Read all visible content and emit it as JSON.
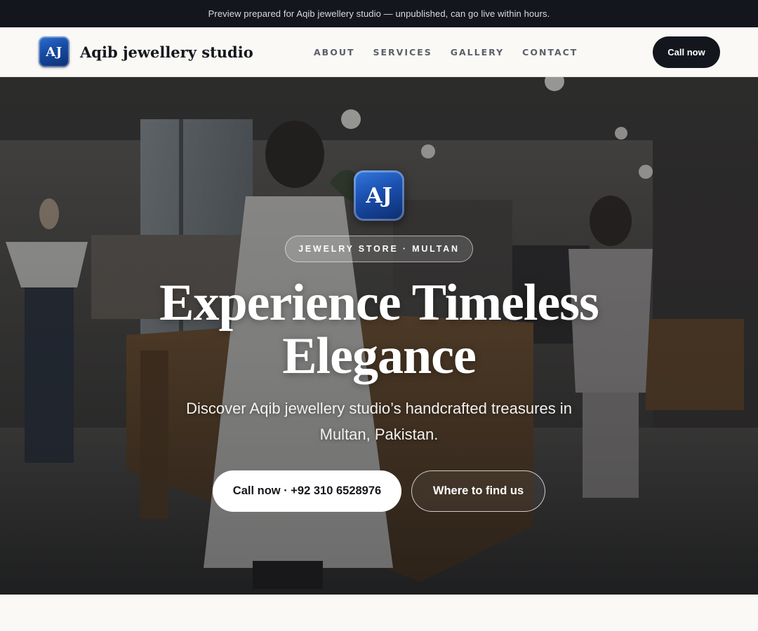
{
  "announcement": {
    "text": "Preview prepared for Aqib jewellery studio — unpublished, can go live within hours."
  },
  "header": {
    "logo_text": "AJ",
    "brand_name": "Aqib jewellery studio",
    "nav": [
      "ABOUT",
      "SERVICES",
      "GALLERY",
      "CONTACT"
    ],
    "cta_label": "Call now"
  },
  "hero": {
    "logo_text": "AJ",
    "chip": "JEWELRY STORE · MULTAN",
    "title": "Experience Timeless Elegance",
    "subtitle": "Discover Aqib jewellery studio’s handcrafted treasures in Multan, Pakistan.",
    "primary_button": "Call now · +92 310 6528976",
    "secondary_button": "Where to find us"
  },
  "colors": {
    "dark": "#13161c",
    "page_bg": "#faf9f6",
    "brand_blue": "#1a4fae",
    "nav_text": "#5b5f69"
  }
}
